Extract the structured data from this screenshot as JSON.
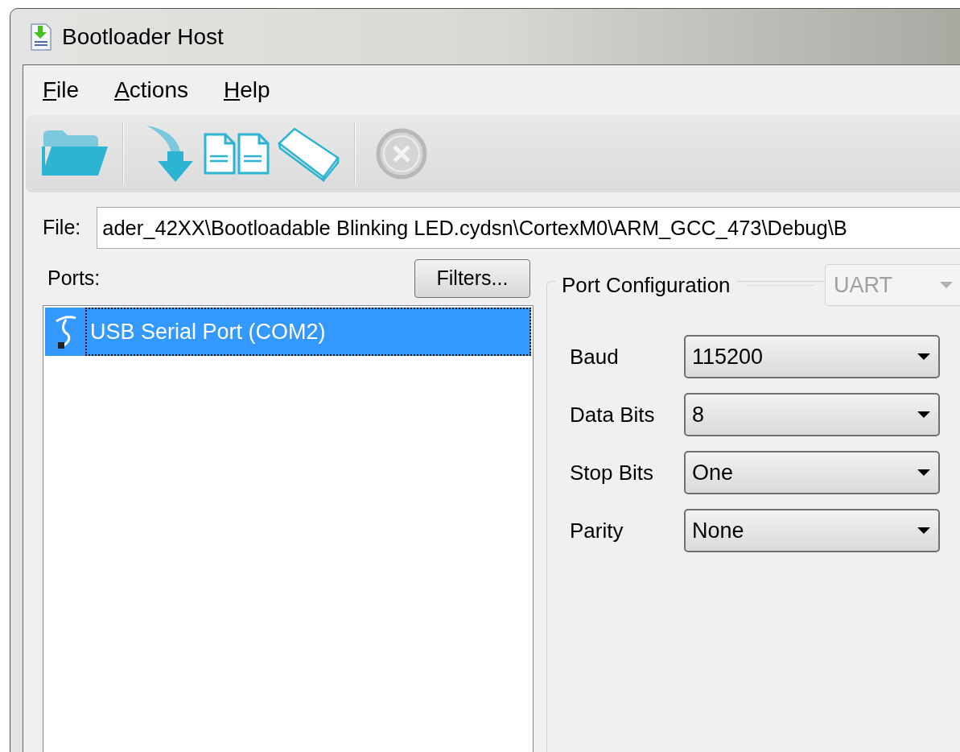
{
  "window": {
    "title": "Bootloader Host"
  },
  "menu": [
    {
      "label": "File"
    },
    {
      "label": "Actions"
    },
    {
      "label": "Help"
    }
  ],
  "toolbar": [
    {
      "kind": "open",
      "disabled": false
    },
    {
      "kind": "separator"
    },
    {
      "kind": "program",
      "disabled": false
    },
    {
      "kind": "verify",
      "disabled": false
    },
    {
      "kind": "erase",
      "disabled": false
    },
    {
      "kind": "separator"
    },
    {
      "kind": "abort",
      "disabled": true
    }
  ],
  "file": {
    "label": "File:",
    "value": "ader_42XX\\Bootloadable Blinking LED.cydsn\\CortexM0\\ARM_GCC_473\\Debug\\B"
  },
  "ports": {
    "label": "Ports:",
    "filters_button": "Filters...",
    "items": [
      {
        "label": "USB Serial Port (COM2)",
        "selected": true
      }
    ]
  },
  "port_configuration": {
    "title": "Port Configuration",
    "protocol": {
      "value": "UART",
      "disabled": true
    },
    "fields": [
      {
        "label": "Baud",
        "value": "115200"
      },
      {
        "label": "Data Bits",
        "value": "8"
      },
      {
        "label": "Stop Bits",
        "value": "One"
      },
      {
        "label": "Parity",
        "value": "None"
      }
    ]
  }
}
